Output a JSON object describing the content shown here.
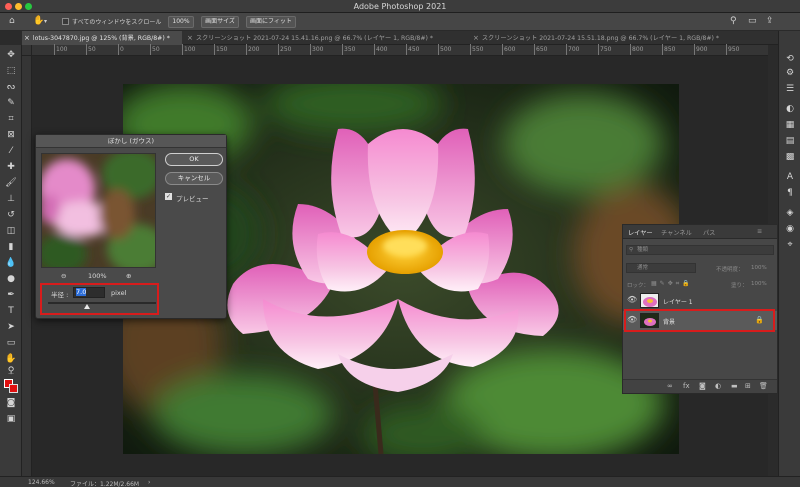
{
  "app": {
    "title": "Adobe Photoshop 2021"
  },
  "options_bar": {
    "home_icon": "home-icon",
    "hand_tool_icon": "hand-icon",
    "scroll_all_label": "すべてのウィンドウをスクロール",
    "zoom_100": "100%",
    "fit_screen": "画面サイズ",
    "fill_screen": "画面にフィット"
  },
  "tabs": [
    {
      "label": "lotus-3047870.jpg @ 125% (背景, RGB/8#) *",
      "active": true
    },
    {
      "label": "スクリーンショット 2021-07-24 15.41.16.png @ 66.7% (レイヤー 1, RGB/8#) *",
      "active": false
    },
    {
      "label": "スクリーンショット 2021-07-24 15.51.18.png @ 66.7% (レイヤー 1, RGB/8#) *",
      "active": false
    }
  ],
  "ruler_labels": [
    "100",
    "50",
    "0",
    "50",
    "100",
    "150",
    "200",
    "250",
    "300",
    "350",
    "400",
    "450",
    "500",
    "550",
    "600",
    "650",
    "700",
    "750",
    "800",
    "850",
    "900",
    "950"
  ],
  "dialog": {
    "title": "ぼかし (ガウス)",
    "ok_label": "OK",
    "cancel_label": "キャンセル",
    "preview_label": "プレビュー",
    "preview_checked": true,
    "zoom_level": "100%",
    "radius_label": "半径 :",
    "radius_value": "7.0",
    "radius_unit": "pixel",
    "radius_slider_fraction": 0.36
  },
  "layers_panel": {
    "tabs": [
      "レイヤー",
      "チャンネル",
      "パス"
    ],
    "search_placeholder": "種類",
    "blend_mode": "通常",
    "opacity_label": "不透明度：",
    "opacity_value": "100%",
    "lock_label": "ロック：",
    "fill_label": "塗り：",
    "fill_value": "100%",
    "layers": [
      {
        "name": "レイヤー 1",
        "visible": true
      },
      {
        "name": "背景",
        "visible": true,
        "locked": true
      }
    ]
  },
  "status": {
    "zoom": "124.66%",
    "file_info": "ファイル：1.22M/2.66M"
  },
  "colors": {
    "highlight_red": "#d81c1c",
    "foreground": "#e01010",
    "background": "#e01010"
  }
}
